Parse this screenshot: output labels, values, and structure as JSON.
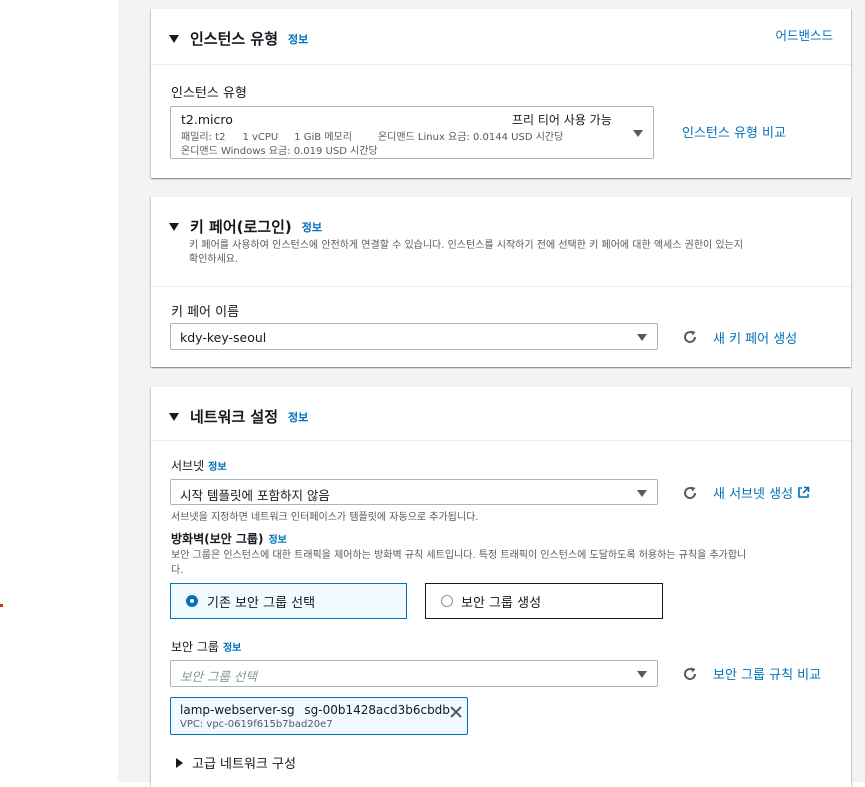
{
  "instance_type_section": {
    "title": "인스턴스 유형",
    "info": "정보",
    "advanced_link": "어드밴스드",
    "field_label": "인스턴스 유형",
    "selected": {
      "name": "t2.micro",
      "badge": "프리 티어 사용 가능",
      "family": "패밀리: t2",
      "vcpu": "1 vCPU",
      "memory": "1 GiB 메모리",
      "linux_price": "온디맨드 Linux 요금: 0.0144 USD 시간당",
      "windows_price": "온디맨드 Windows 요금: 0.019 USD 시간당"
    },
    "compare_link": "인스턴스 유형 비교"
  },
  "key_pair_section": {
    "title": "키 페어(로그인)",
    "info": "정보",
    "desc_line1": "키 페어를 사용하여 인스턴스에 안전하게 연결할 수 있습니다. 인스턴스를 시작하기 전에 선택한 키 페어에 대한 액세스 권한이 있는지",
    "desc_line2": "확인하세요.",
    "field_label": "키 페어 이름",
    "selected": "kdy-key-seoul",
    "create_link": "새 키 페어 생성"
  },
  "network_section": {
    "title": "네트워크 설정",
    "info": "정보",
    "subnet_label": "서브넷",
    "subnet_info": "정보",
    "subnet_selected": "시작 템플릿에 포함하지 않음",
    "subnet_create_link": "새 서브넷 생성",
    "subnet_help": "서브넷을 지정하면 네트워크 인터페이스가 템플릿에 자동으로 추가됩니다.",
    "firewall_label": "방화벽(보안 그룹)",
    "firewall_info": "정보",
    "firewall_desc_line1": "보안 그룹은 인스턴스에 대한 트래픽을 제어하는 방화벽 규칙 세트입니다. 특정 트래픽이 인스턴스에 도달하도록 허용하는 규칙을 추가합니",
    "firewall_desc_line2": "다.",
    "option_existing": "기존 보안 그룹 선택",
    "option_create": "보안 그룹 생성",
    "sg_label": "보안 그룹",
    "sg_info": "정보",
    "sg_placeholder": "보안 그룹 선택",
    "sg_compare_link": "보안 그룹 규칙 비교",
    "sg_token_name": "lamp-webserver-sg",
    "sg_token_id": "sg-00b1428acd3b6cbdb",
    "sg_token_vpc": "VPC: vpc-0619f615b7bad20e7",
    "advanced_label": "고급 네트워크 구성"
  },
  "colors": {
    "link": "#0073bb",
    "selected_border": "#0073bb",
    "selected_bg": "#f1faff",
    "tile_border": "#16191f"
  }
}
